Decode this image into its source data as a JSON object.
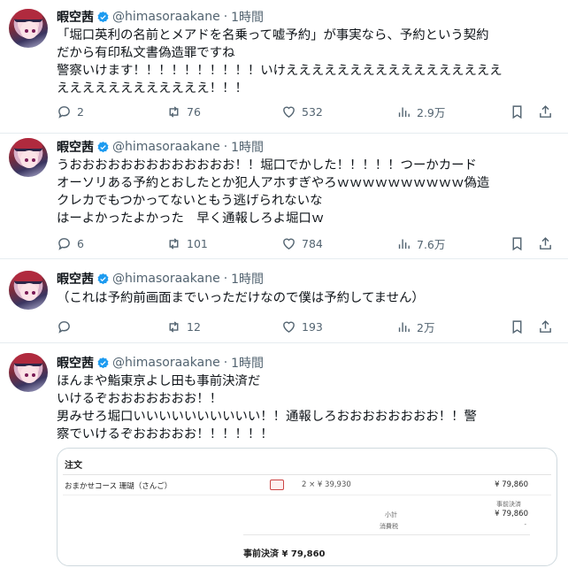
{
  "tweets": [
    {
      "name": "暇空茜",
      "handle": "@himasoraakane",
      "dot": "·",
      "time": "1時間",
      "text": "「堀口英利の名前とメアドを名乗って嘘予約」が事実なら、予約という契約\nだから有印私文書偽造罪ですね\n警察いけます！！！！！！！！！！いけえええええええええええええええええ\nええええええええええええ！！！",
      "replies": "2",
      "retweets": "76",
      "likes": "532",
      "views": "2.9万"
    },
    {
      "name": "暇空茜",
      "handle": "@himasoraakane",
      "dot": "·",
      "time": "1時間",
      "text": "うおおおおおおおおおおおおお！！堀口でかした！！！！！つーかカード\nオーソリある予約とおしたとか犯人アホすぎやろｗｗｗｗｗｗｗｗｗｗ偽造\nクレカでもつかってないともう逃げられないな\nはーよかったよかった　早く通報しろよ堀口ｗ",
      "replies": "6",
      "retweets": "101",
      "likes": "784",
      "views": "7.6万"
    },
    {
      "name": "暇空茜",
      "handle": "@himasoraakane",
      "dot": "·",
      "time": "1時間",
      "text": "（これは予約前画面までいっただけなので僕は予約してません）",
      "replies": "",
      "retweets": "12",
      "likes": "193",
      "views": "2万"
    },
    {
      "name": "暇空茜",
      "handle": "@himasoraakane",
      "dot": "·",
      "time": "1時間",
      "text": "ほんまや鮨東京よし田も事前決済だ\nいけるぞおおおおおおお！！\n男みせろ堀口いいいいいいいいいい！！通報しろおおおおおおおお！！警\n察でいけるぞおおおおお！！！！！！"
    }
  ],
  "receipt": {
    "title": "注文",
    "course": "おまかせコース 珊瑚（さんご）",
    "qty": "2 × ¥ 39,930",
    "price": "¥ 79,860",
    "paid_label": "事前決済",
    "subtotal_label": "小計",
    "subtotal": "¥ 79,860",
    "fee_label": "消費税",
    "fee": "-",
    "total": "事前決済  ¥ 79,860"
  },
  "colors": {
    "verified": "#1d9bf0",
    "muted": "#536471",
    "text": "#0f1419"
  }
}
